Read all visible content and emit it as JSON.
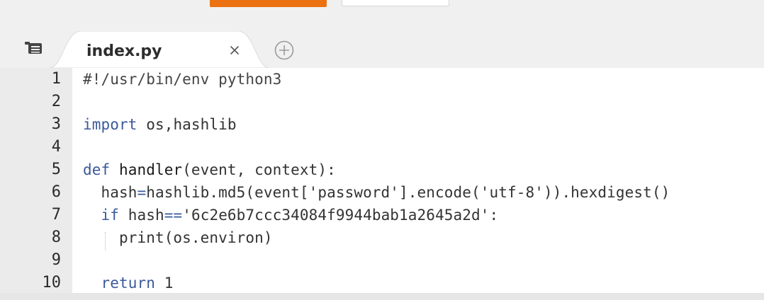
{
  "tab": {
    "label": "index.py",
    "close_glyph": "×",
    "close_icon": "close-icon",
    "add_icon": "plus-circle-icon"
  },
  "toolbar": {
    "primary_button_color": "#ec7211"
  },
  "file_menu_icon": "file-menu-icon",
  "editor": {
    "lines": [
      {
        "number": "1",
        "segments": [
          {
            "t": "#!/usr/bin/env python3",
            "k": "cmt"
          }
        ]
      },
      {
        "number": "2",
        "segments": []
      },
      {
        "number": "3",
        "segments": [
          {
            "t": "import",
            "k": "kw"
          },
          {
            "t": " os,hashlib",
            "k": "plain"
          }
        ]
      },
      {
        "number": "4",
        "segments": []
      },
      {
        "number": "5",
        "segments": [
          {
            "t": "def",
            "k": "kw"
          },
          {
            "t": " handler",
            "k": "fn"
          },
          {
            "t": "(event, context):",
            "k": "plain"
          }
        ]
      },
      {
        "number": "6",
        "segments": [
          {
            "t": "  hash",
            "k": "plain"
          },
          {
            "t": "=",
            "k": "kw"
          },
          {
            "t": "hashlib.md5(event[",
            "k": "plain"
          },
          {
            "t": "'password'",
            "k": "str"
          },
          {
            "t": "].encode(",
            "k": "plain"
          },
          {
            "t": "'utf-8'",
            "k": "str"
          },
          {
            "t": ")).hexdigest()",
            "k": "plain"
          }
        ]
      },
      {
        "number": "7",
        "segments": [
          {
            "t": "  ",
            "k": "plain"
          },
          {
            "t": "if",
            "k": "kw"
          },
          {
            "t": " hash",
            "k": "plain"
          },
          {
            "t": "==",
            "k": "kw"
          },
          {
            "t": "'6c2e6b7ccc34084f9944bab1a2645a2d'",
            "k": "str"
          },
          {
            "t": ":",
            "k": "plain"
          }
        ]
      },
      {
        "number": "8",
        "segments": [
          {
            "t": "    print(os.environ)",
            "k": "plain"
          }
        ]
      },
      {
        "number": "9",
        "segments": []
      },
      {
        "number": "10",
        "segments": [
          {
            "t": "  ",
            "k": "plain"
          },
          {
            "t": "return",
            "k": "kw"
          },
          {
            "t": " 1",
            "k": "plain"
          }
        ]
      }
    ]
  }
}
